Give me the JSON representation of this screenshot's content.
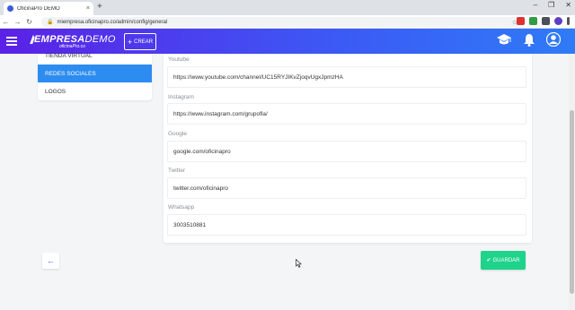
{
  "browser": {
    "tab_title": "OficinaPro DEMO",
    "tab_close": "×",
    "new_tab": "+",
    "url": "miempresa.oficinapro.co/admin/config/general",
    "minimize": "–",
    "maximize": "❐",
    "close": "✕"
  },
  "header": {
    "logo_main_bold": "EMPRESA",
    "logo_main_light": "DEMO",
    "logo_sub": "oficinaPro.co",
    "create_button": "CREAR",
    "create_icon": "+"
  },
  "sidebar": {
    "items": [
      {
        "label": "TIENDA VIRTUAL",
        "active": false
      },
      {
        "label": "REDES SOCIALES",
        "active": true
      },
      {
        "label": "LOGOS",
        "active": false
      }
    ]
  },
  "form": {
    "fields": [
      {
        "label": "Youtube",
        "value": "https://www.youtube.com/channel/UC15RYJIKvZjoqvUgxJpmzHA"
      },
      {
        "label": "Instagram",
        "value": "https://www.instagram.com/grupofla/"
      },
      {
        "label": "Google",
        "value": "google.com/oficinapro"
      },
      {
        "label": "Twitter",
        "value": "twitter.com/oficinapro"
      },
      {
        "label": "Whatsapp",
        "value": "3003510881"
      }
    ]
  },
  "actions": {
    "back_icon": "←",
    "save_label": "GUARDAR",
    "save_icon": "✔"
  },
  "colors": {
    "header_gradient_start": "#5b21e6",
    "header_gradient_end": "#2f7bf7",
    "active_menu": "#2d8cf0",
    "save_button": "#1fd38b"
  }
}
